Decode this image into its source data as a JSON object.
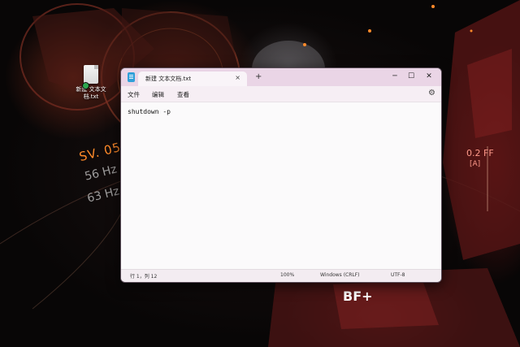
{
  "desktop": {
    "icon_label": "新建 文本文档.txt",
    "wallpaper_text": [
      "SV. 05",
      "56 Hz",
      "63 Hz",
      "0.2 FF",
      "[A]",
      "BF+"
    ]
  },
  "notepad": {
    "tab_title": "新建 文本文档.txt",
    "tab_close": "×",
    "new_tab": "+",
    "controls": {
      "minimize": "─",
      "maximize": "☐",
      "close": "✕"
    },
    "menu": [
      "文件",
      "编辑",
      "查看"
    ],
    "settings_icon": "⚙",
    "content": "shutdown -p",
    "status": {
      "position": "行 1，列 12",
      "zoom": "100%",
      "line_ending": "Windows (CRLF)",
      "encoding": "UTF-8"
    }
  },
  "colors": {
    "titlebar": "#ead5e6",
    "editor_bg": "#fbfafb",
    "accent_orange": "#ff8a2a"
  }
}
